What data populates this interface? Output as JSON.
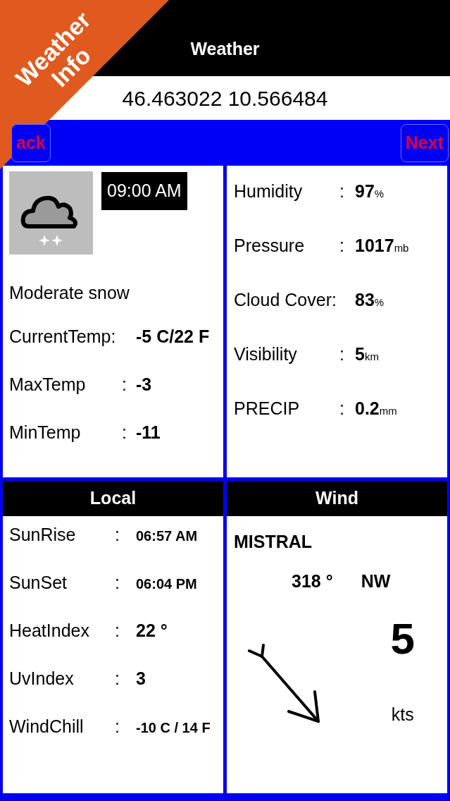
{
  "ribbon": {
    "lines": [
      "Weather",
      "Info"
    ]
  },
  "header": {
    "title": "Weather"
  },
  "coordinates": "46.463022 10.566484",
  "nav": {
    "back": "ack",
    "next": "Next"
  },
  "conditions": {
    "time": "09:00 AM",
    "description": "Moderate snow",
    "rows": [
      {
        "label": "CurrentTemp:",
        "value": "-5 C/22 F"
      },
      {
        "label": "MaxTemp",
        "sep": ":",
        "value": "-3"
      },
      {
        "label": "MinTemp",
        "sep": ":",
        "value": "-11"
      }
    ]
  },
  "atmosphere": {
    "rows": [
      {
        "label": "Humidity",
        "sep": ":",
        "value": "97",
        "unit": "%"
      },
      {
        "label": "Pressure",
        "sep": ":",
        "value": "1017",
        "unit": "mb"
      },
      {
        "label": "Cloud Cover:",
        "value": "83",
        "unit": "%"
      },
      {
        "label": "Visibility",
        "sep": ":",
        "value": "5",
        "unit": "km"
      },
      {
        "label": "PRECIP",
        "sep": ":",
        "value": "0.2",
        "unit": "mm"
      }
    ]
  },
  "local": {
    "title": "Local",
    "rows": [
      {
        "label": "SunRise",
        "sep": ":",
        "value": "06:57 AM",
        "kind": "small"
      },
      {
        "label": "SunSet",
        "sep": ":",
        "value": "06:04 PM",
        "kind": "small"
      },
      {
        "label": "HeatIndex",
        "sep": ":",
        "value": "22 °",
        "kind": "large"
      },
      {
        "label": "UvIndex",
        "sep": ":",
        "value": "3",
        "kind": "large"
      },
      {
        "label": "WindChill",
        "sep": ":",
        "value": "-10 C / 14 F",
        "kind": "small"
      }
    ]
  },
  "wind": {
    "title": "Wind",
    "name": "MISTRAL",
    "degrees": "318 °",
    "direction": "NW",
    "speed": "5",
    "unit": "kts"
  }
}
